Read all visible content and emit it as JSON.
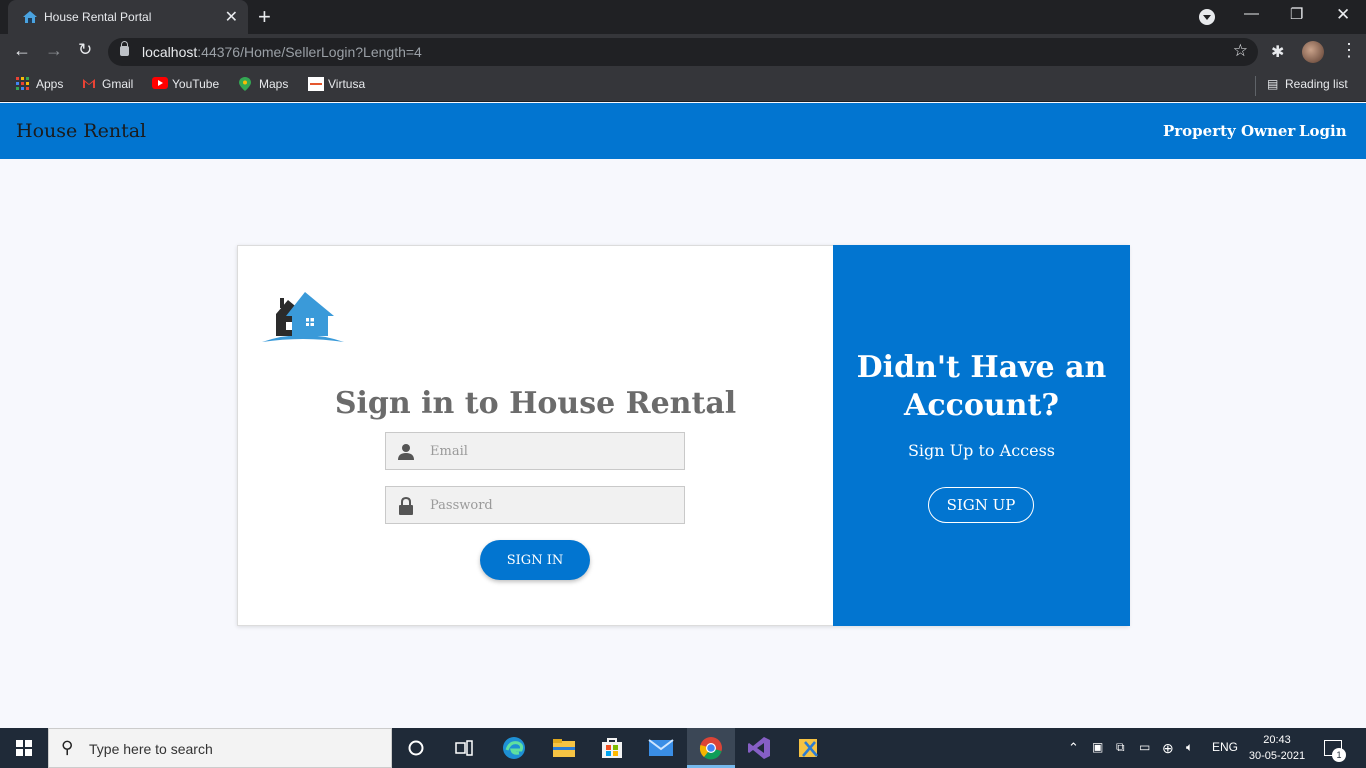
{
  "browser": {
    "tab_title": "House Rental Portal",
    "url_host": "localhost",
    "url_rest": ":44376/Home/SellerLogin?Length=4",
    "bookmarks": [
      "Apps",
      "Gmail",
      "YouTube",
      "Maps",
      "Virtusa"
    ],
    "reading_list": "Reading list"
  },
  "navbar": {
    "brand": "House Rental",
    "links": [
      "Property Owner",
      "Login"
    ],
    "accent_color": "#0275d0"
  },
  "signin": {
    "title": "Sign in to House Rental",
    "email_placeholder": "Email",
    "password_placeholder": "Password",
    "button": "SIGN IN"
  },
  "signup_panel": {
    "title_line1": "Didn't Have an",
    "title_line2": "Account?",
    "subtitle": "Sign Up to Access",
    "button": "SIGN UP"
  },
  "taskbar": {
    "search_placeholder": "Type here to search",
    "language": "ENG",
    "time": "20:43",
    "date": "30-05-2021",
    "notification_count": "1"
  }
}
